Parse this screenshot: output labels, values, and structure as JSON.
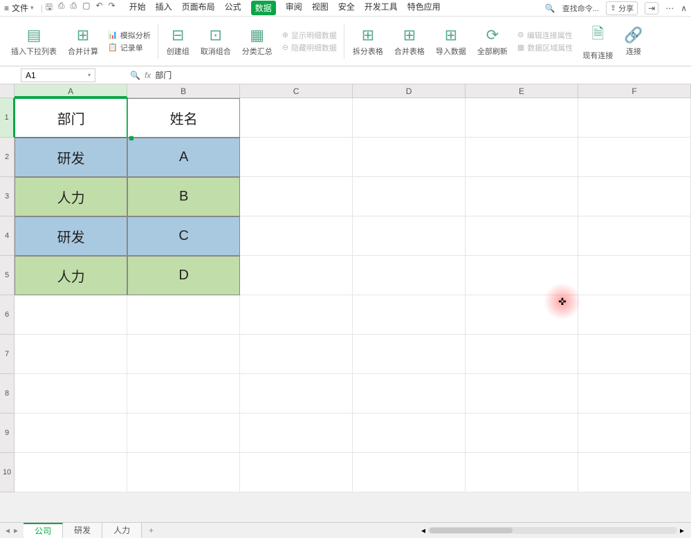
{
  "menubar": {
    "file": "文件",
    "tabs": [
      "开始",
      "插入",
      "页面布局",
      "公式",
      "数据",
      "审阅",
      "视图",
      "安全",
      "开发工具",
      "特色应用"
    ],
    "active_tab": 4,
    "search_placeholder": "查找命令...",
    "share": "分享"
  },
  "ribbon": {
    "g1": "插入下拉列表",
    "g2": "合并计算",
    "g3a": "模拟分析",
    "g3b": "记录单",
    "g4": "创建组",
    "g5": "取消组合",
    "g6": "分类汇总",
    "g7a": "显示明细数据",
    "g7b": "隐藏明细数据",
    "g8": "拆分表格",
    "g9": "合并表格",
    "g10": "导入数据",
    "g11": "全部刷新",
    "g12a": "编辑连接属性",
    "g12b": "数据区域属性",
    "g13": "现有连接",
    "g14": "连接"
  },
  "refbar": {
    "cell": "A1",
    "formula": "部门"
  },
  "columns": [
    "A",
    "B",
    "C",
    "D",
    "E",
    "F"
  ],
  "row_nums": [
    "1",
    "2",
    "3",
    "4",
    "5",
    "6",
    "7",
    "8",
    "9",
    "10"
  ],
  "table": {
    "header": [
      "部门",
      "姓名"
    ],
    "rows": [
      {
        "dept": "研发",
        "name": "A",
        "color": "blue"
      },
      {
        "dept": "人力",
        "name": "B",
        "color": "green"
      },
      {
        "dept": "研发",
        "name": "C",
        "color": "blue"
      },
      {
        "dept": "人力",
        "name": "D",
        "color": "green"
      }
    ]
  },
  "sheets": {
    "items": [
      "公司",
      "研发",
      "人力"
    ],
    "active": 0
  }
}
